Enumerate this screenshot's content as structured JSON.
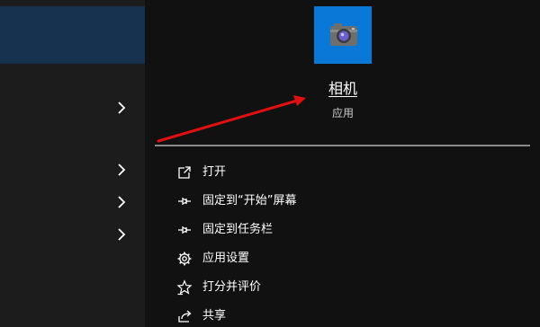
{
  "app": {
    "name": "相机",
    "type": "应用"
  },
  "menu": {
    "items": [
      {
        "label": "打开",
        "icon": "open-icon"
      },
      {
        "label": "固定到“开始”屏幕",
        "icon": "pin-icon"
      },
      {
        "label": "固定到任务栏",
        "icon": "pin-icon"
      },
      {
        "label": "应用设置",
        "icon": "gear-icon"
      },
      {
        "label": "打分并评价",
        "icon": "star-rate-icon"
      },
      {
        "label": "共享",
        "icon": "share-icon"
      }
    ]
  },
  "colors": {
    "tile": "#0a78d7",
    "selected_row": "#17324f",
    "annotation_arrow": "#e01010"
  }
}
